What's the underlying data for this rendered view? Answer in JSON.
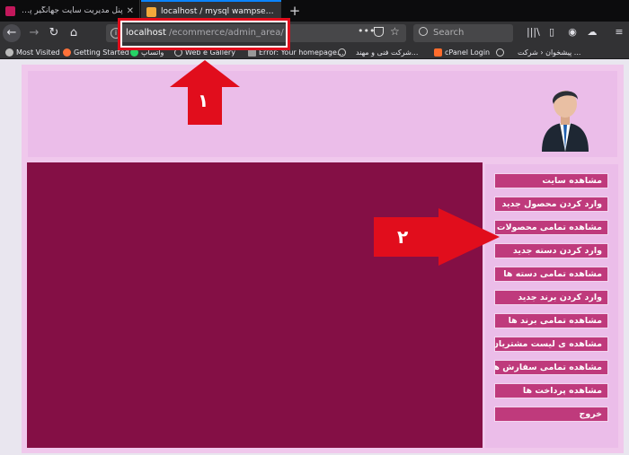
{
  "tabs": [
    {
      "title": "پنل مدیریت سایت جهانگیر پوکم",
      "active": false
    },
    {
      "title": "localhost / mysql wampserver | ph",
      "active": true
    }
  ],
  "address": {
    "host": "localhost",
    "path": "/ecommerce/admin_area/"
  },
  "search": {
    "placeholder": "Search"
  },
  "bookmarks": [
    "Most Visited",
    "Getting Started",
    "واتساپ",
    "Web   e Gallery",
    "Error: Your homepage...",
    "شرکت فنی و مهند...",
    "cPanel Login",
    "پیشخوان ‹ شرکت ..."
  ],
  "menu": [
    "مشاهده سایت",
    "وارد کردن محصول جدید",
    "مشاهده تمامی محصولات",
    "وارد کردن دسته جدید",
    "مشاهده تمامی دسته ها",
    "وارد کردن برند جدید",
    "مشاهده تمامی برند ها",
    "مشاهده ی لیست مشتریان",
    "مشاهده تمامی سفارش ها",
    "مشاهده پرداخت ها",
    "خروج"
  ],
  "annotations": {
    "step1": "۱",
    "step2": "۲"
  },
  "colors": {
    "highlight": "#e10d1c",
    "content_bg": "#840f45",
    "menu_btn": "#bf3a7c",
    "header_bg": "#ebbde9"
  }
}
